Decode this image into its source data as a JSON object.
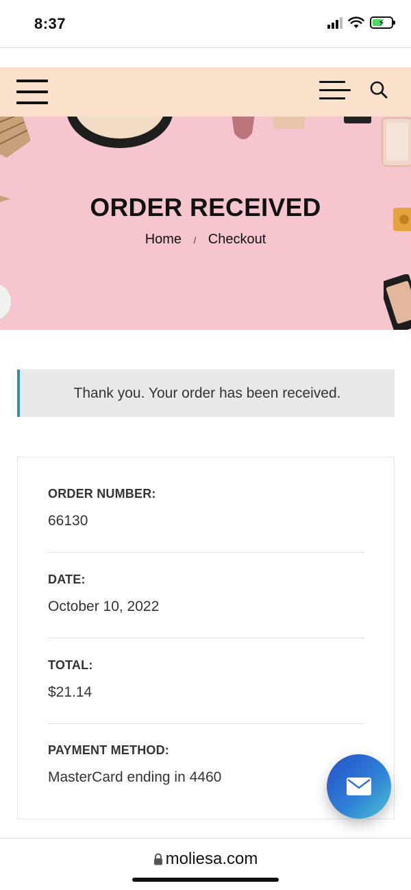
{
  "status_bar": {
    "time": "8:37",
    "icons": [
      "signal-icon",
      "wifi-icon",
      "battery-charging-icon"
    ]
  },
  "header": {
    "left_menu_icon": "hamburger-icon",
    "right_menu_icon": "menu-lines-icon",
    "search_icon": "search-icon",
    "background": "#fae1cb"
  },
  "hero": {
    "title": "ORDER RECEIVED",
    "breadcrumb": {
      "home": "Home",
      "separator": "/",
      "current": "Checkout"
    },
    "background": "#f6c6cf"
  },
  "notice": {
    "text": "Thank you. Your order has been received.",
    "accent": "#2d8fb0"
  },
  "order_details": [
    {
      "label": "ORDER NUMBER:",
      "value": "66130"
    },
    {
      "label": "DATE:",
      "value": "October 10, 2022"
    },
    {
      "label": "TOTAL:",
      "value": "$21.14"
    },
    {
      "label": "PAYMENT METHOD:",
      "value": "MasterCard ending in 4460"
    }
  ],
  "fab": {
    "icon": "mail-icon"
  },
  "browser": {
    "url": "moliesa.com",
    "lock_icon": "lock-icon"
  }
}
